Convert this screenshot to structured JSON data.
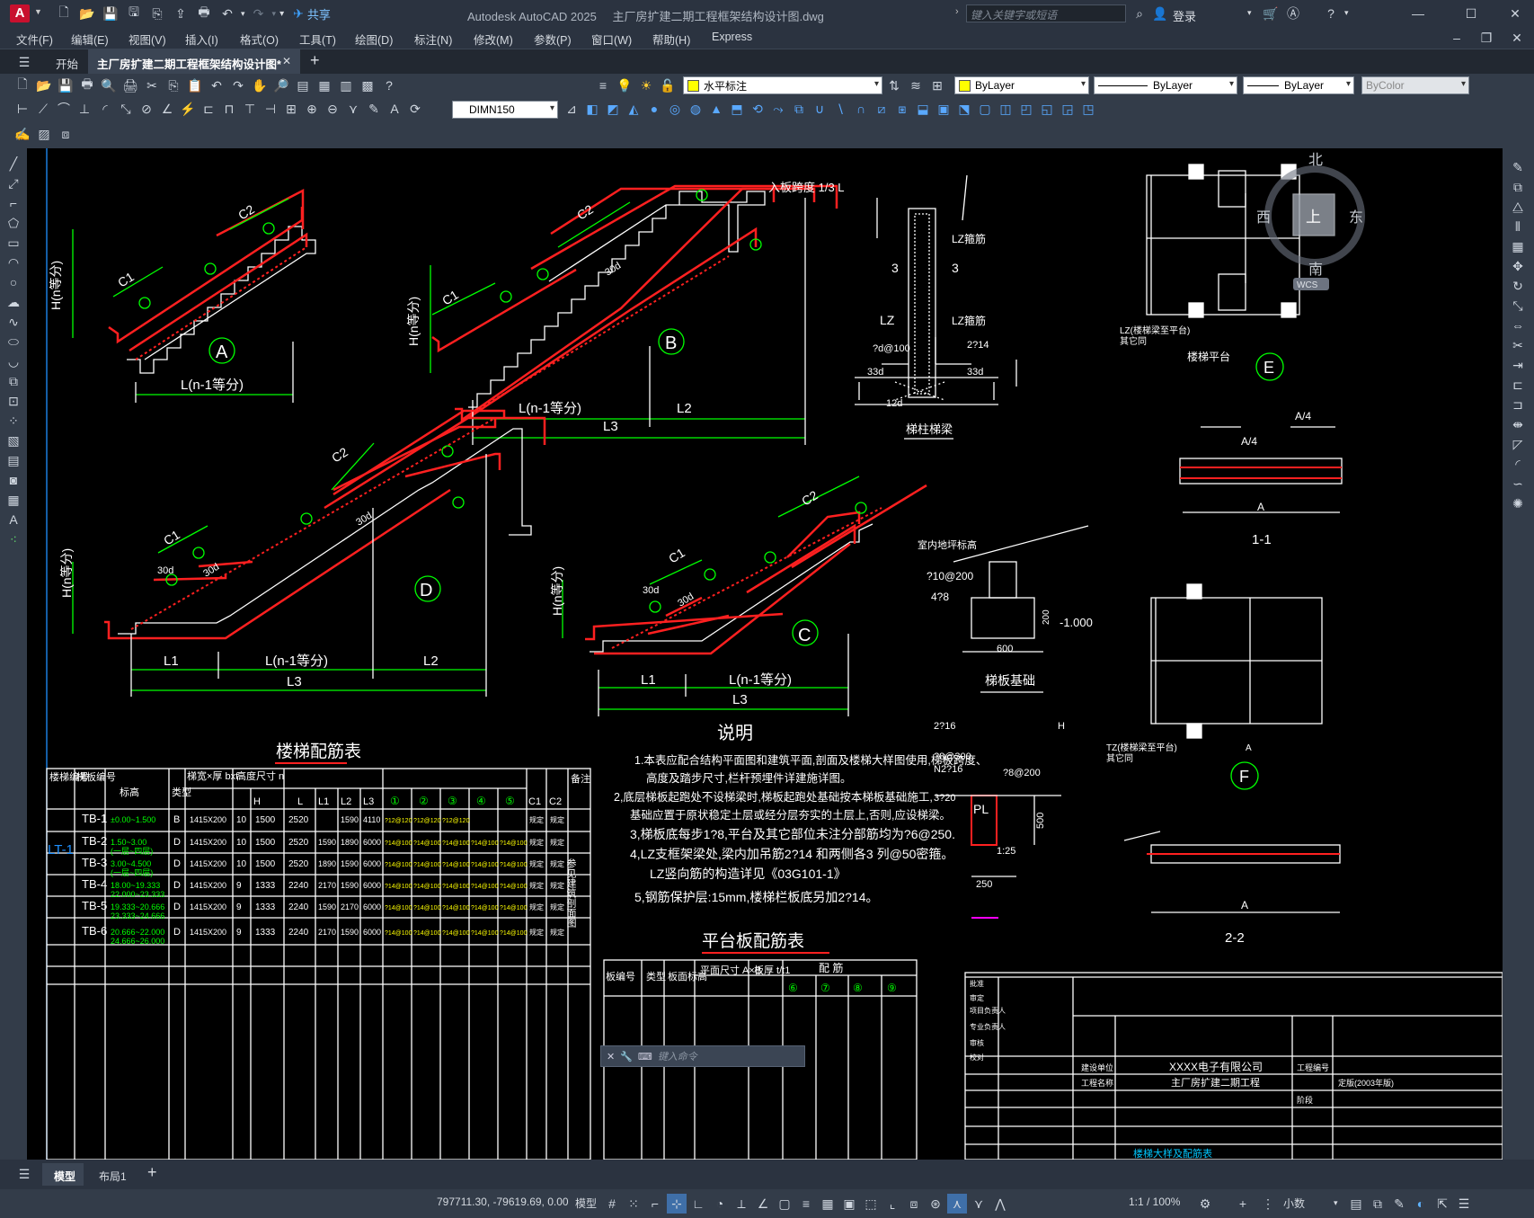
{
  "title_bar": {
    "app_title": "Autodesk AutoCAD 2025",
    "doc_title": "主厂房扩建二期工程框架结构设计图.dwg",
    "share_label": "共享",
    "search_placeholder": "键入关键字或短语",
    "signin_label": "登录"
  },
  "menus": [
    "文件(F)",
    "编辑(E)",
    "视图(V)",
    "插入(I)",
    "格式(O)",
    "工具(T)",
    "绘图(D)",
    "标注(N)",
    "修改(M)",
    "参数(P)",
    "窗口(W)",
    "帮助(H)",
    "Express"
  ],
  "tabs": {
    "start": "开始",
    "doc": "主厂房扩建二期工程框架结构设计图*"
  },
  "layer": {
    "name": "水平标注",
    "color": "#ffff00"
  },
  "properties": {
    "color": "ByLayer",
    "linetype": "ByLayer",
    "lineweight": "ByLayer",
    "plotstyle": "ByColor"
  },
  "dimstyle": "DIMN150",
  "viewcube": {
    "north": "北",
    "south": "南",
    "east": "东",
    "west": "西",
    "top": "上",
    "wcs": "WCS"
  },
  "layout_tabs": {
    "model": "模型",
    "layout1": "布局1"
  },
  "command_placeholder": "键入命令",
  "status": {
    "coords": "797711.30, -79619.69, 0.00",
    "space": "模型",
    "scale": "1:1 / 100%",
    "units": "小数"
  },
  "drawing": {
    "labels": {
      "A": "A",
      "B": "B",
      "C": "C",
      "D": "D",
      "E": "E",
      "F": "F",
      "HN": "H(n等分)",
      "LN": "L(n-1等分)",
      "L1": "L1",
      "L2": "L2",
      "L3": "L3",
      "C1": "C1",
      "C2": "C2",
      "d30": "30d",
      "ruban": "入板跨度 1/3 L",
      "tiban_liang": "梯柱梯梁",
      "tiban_jichu": "梯板基础",
      "louti_pingtai": "楼梯平台",
      "sec11": "1-1",
      "sec22": "2-2",
      "shinei": "室内地坪标高",
      "lz_label": "LZ",
      "lz_gu": "LZ箍筋",
      "dim3": "3",
      "p600": "600",
      "p200": "200",
      "p250": "250",
      "p500": "500",
      "m1000": "-1.000",
      "pL": "PL",
      "a4": "A/4",
      "a_label": "A",
      "b_label": "B",
      "tz_note": "TZ(楼梯梁至平台)",
      "lz_note": "LZ(楼梯梁至平台)",
      "qita": "其它同",
      "r210": "?10@200",
      "r418": "4?8",
      "r216": "2?16",
      "r8300": "?8@300",
      "n216": "N2?16",
      "r8200": "?8@200",
      "r320": "3?20",
      "r125": "1:25",
      "r12d": "12d",
      "r33d": "33d",
      "r2d100": "?d@100",
      "r214": "2?14",
      "h_label": "H"
    },
    "table_title": "楼梯配筋表",
    "table_headers": [
      "楼梯编号",
      "梯板编号",
      "标高",
      "类型",
      "梯宽×厚 bxt",
      "高度尺寸 n",
      "H",
      "L",
      "L1",
      "L2",
      "L3",
      "①",
      "②",
      "③",
      "④",
      "⑤",
      "C1",
      "C2",
      "备注"
    ],
    "group_label": "LT-1",
    "remark": "参见建筑剖面图",
    "table_rows": [
      {
        "id": "TB-1",
        "elev": "±0.00~1.500",
        "elev2": "",
        "type": "B",
        "bt": "1415X200",
        "n": "10",
        "H": "1500",
        "L": "2520",
        "L1": "",
        "L2": "1590",
        "L3": "4110",
        "r1": "?12@120",
        "r2": "?12@120",
        "r3": "?12@120",
        "r4": "",
        "r5": "",
        "c1": "规定",
        "c2": "规定"
      },
      {
        "id": "TB-2",
        "elev": "1.50~3.00",
        "elev2": "(一层~四层)",
        "type": "D",
        "bt": "1415X200",
        "n": "10",
        "H": "1500",
        "L": "2520",
        "L1": "1590",
        "L2": "1890",
        "L3": "6000",
        "r1": "?14@100",
        "r2": "?14@100",
        "r3": "?14@100",
        "r4": "?14@100",
        "r5": "?14@100",
        "c1": "规定",
        "c2": "规定"
      },
      {
        "id": "TB-3",
        "elev": "3.00~4.500",
        "elev2": "(一层~四层)",
        "type": "D",
        "bt": "1415X200",
        "n": "10",
        "H": "1500",
        "L": "2520",
        "L1": "1890",
        "L2": "1590",
        "L3": "6000",
        "r1": "?14@100",
        "r2": "?14@100",
        "r3": "?14@100",
        "r4": "?14@100",
        "r5": "?14@100",
        "c1": "规定",
        "c2": "规定"
      },
      {
        "id": "TB-4",
        "elev": "18.00~19.333",
        "elev2": "22.000~23.333",
        "type": "D",
        "bt": "1415X200",
        "n": "9",
        "H": "1333",
        "L": "2240",
        "L1": "2170",
        "L2": "1590",
        "L3": "6000",
        "r1": "?14@100",
        "r2": "?14@100",
        "r3": "?14@100",
        "r4": "?14@100",
        "r5": "?14@100",
        "c1": "规定",
        "c2": "规定"
      },
      {
        "id": "TB-5",
        "elev": "19.333~20.666",
        "elev2": "23.333~24.666",
        "type": "D",
        "bt": "1415X200",
        "n": "9",
        "H": "1333",
        "L": "2240",
        "L1": "1590",
        "L2": "2170",
        "L3": "6000",
        "r1": "?14@100",
        "r2": "?14@100",
        "r3": "?14@100",
        "r4": "?14@100",
        "r5": "?14@100",
        "c1": "规定",
        "c2": "规定"
      },
      {
        "id": "TB-6",
        "elev": "20.666~22.000",
        "elev2": "24.666~26.000",
        "type": "D",
        "bt": "1415X200",
        "n": "9",
        "H": "1333",
        "L": "2240",
        "L1": "2170",
        "L2": "1590",
        "L3": "6000",
        "r1": "?14@100",
        "r2": "?14@100",
        "r3": "?14@100",
        "r4": "?14@100",
        "r5": "?14@100",
        "c1": "规定",
        "c2": "规定"
      }
    ],
    "notes_title": "说明",
    "notes": [
      "1.本表应配合结构平面图和建筑平面,剖面及楼梯大样图使用,梯板跨度、",
      "高度及踏步尺寸,栏杆预埋件详建施详图。",
      "2,底层梯板起跑处不设梯梁时,梯板起跑处基础按本梯板基础施工,",
      "基础应置于原状稳定土层或经分层夯实的土层上,否则,应设梯梁。",
      "3,梯板底每步1?8,平台及其它部位未注分部筋均为?6@250.",
      "4,LZ支框架梁处,梁内加吊筋2?14 和两侧各3 列@50密箍。",
      "LZ竖向筋的构造详见《03G101-1》",
      "5,钢筋保护层:15mm,楼梯栏板底另加2?14。"
    ],
    "platform_title": "平台板配筋表",
    "platform_headers": [
      "板编号",
      "类型",
      "板面标高",
      "平面尺寸 A×B",
      "板厚 t/t1",
      "⑥",
      "⑦",
      "⑧",
      "⑨"
    ],
    "platform_group": "配 筋",
    "titleblock": {
      "company": "XXXX电子有限公司",
      "project": "主厂房扩建二期工程",
      "rows": [
        "批准",
        "审定",
        "项目负责人",
        "专业负责人",
        "审核",
        "校对"
      ],
      "build_unit": "建设单位",
      "proj_name": "工程名称",
      "proj_no": "工程编号",
      "phase": "阶段",
      "version": "定版(2003年版)",
      "drawing_title": "楼梯大样及配筋表"
    }
  }
}
